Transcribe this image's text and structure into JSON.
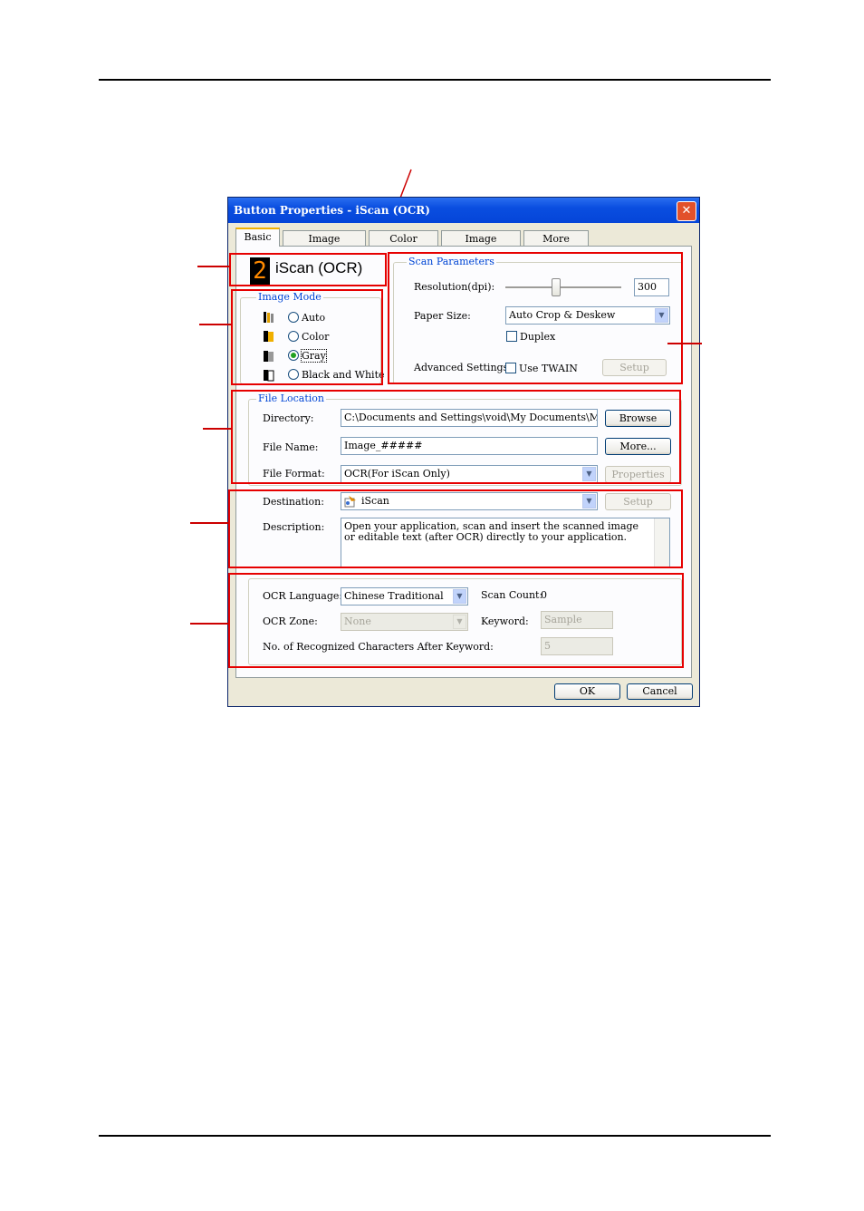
{
  "window": {
    "title": "Button Properties - iScan (OCR)",
    "close_glyph": "✕"
  },
  "tabs": [
    "Basic",
    "Image Adjustment",
    "Color Dropout",
    "Image Processing",
    "More Settings"
  ],
  "button_badge": {
    "number": "2",
    "name": "iScan (OCR)"
  },
  "image_mode": {
    "legend": "Image Mode",
    "options": [
      "Auto",
      "Color",
      "Gray",
      "Black and White"
    ],
    "selected": "Gray"
  },
  "scan_parameters": {
    "legend": "Scan Parameters",
    "resolution_label": "Resolution(dpi):",
    "resolution_value": "300",
    "paper_size_label": "Paper Size:",
    "paper_size_value": "Auto Crop & Deskew",
    "duplex_label": "Duplex",
    "advanced_label": "Advanced Settings:",
    "use_twain_label": "Use TWAIN",
    "setup_label": "Setup"
  },
  "file_location": {
    "legend": "File Location",
    "directory_label": "Directory:",
    "directory_value": "C:\\Documents and Settings\\void\\My Documents\\My Pictures",
    "browse_label": "Browse",
    "file_name_label": "File Name:",
    "file_name_value": "Image_#####",
    "more_label": "More...",
    "file_format_label": "File Format:",
    "file_format_value": "OCR(For iScan Only)",
    "properties_label": "Properties"
  },
  "destination": {
    "label": "Destination:",
    "value": "iScan",
    "setup_label": "Setup",
    "description_label": "Description:",
    "description_text": "Open your application, scan and insert the scanned image or editable text (after OCR) directly to your application."
  },
  "ocr": {
    "language_label": "OCR Language:",
    "language_value": "Chinese Traditional",
    "scan_count_label": "Scan Count:",
    "scan_count_value": "0",
    "zone_label": "OCR Zone:",
    "zone_value": "None",
    "keyword_label": "Keyword:",
    "keyword_placeholder": "Sample",
    "chars_label": "No. of Recognized Characters After Keyword:",
    "chars_value": "5"
  },
  "footer": {
    "ok_label": "OK",
    "cancel_label": "Cancel"
  },
  "colors": {
    "annotation": "#e60000",
    "titlebar": "#0a4ee0",
    "dialog_bg": "#ece9d8",
    "group_label": "#0046d5"
  }
}
